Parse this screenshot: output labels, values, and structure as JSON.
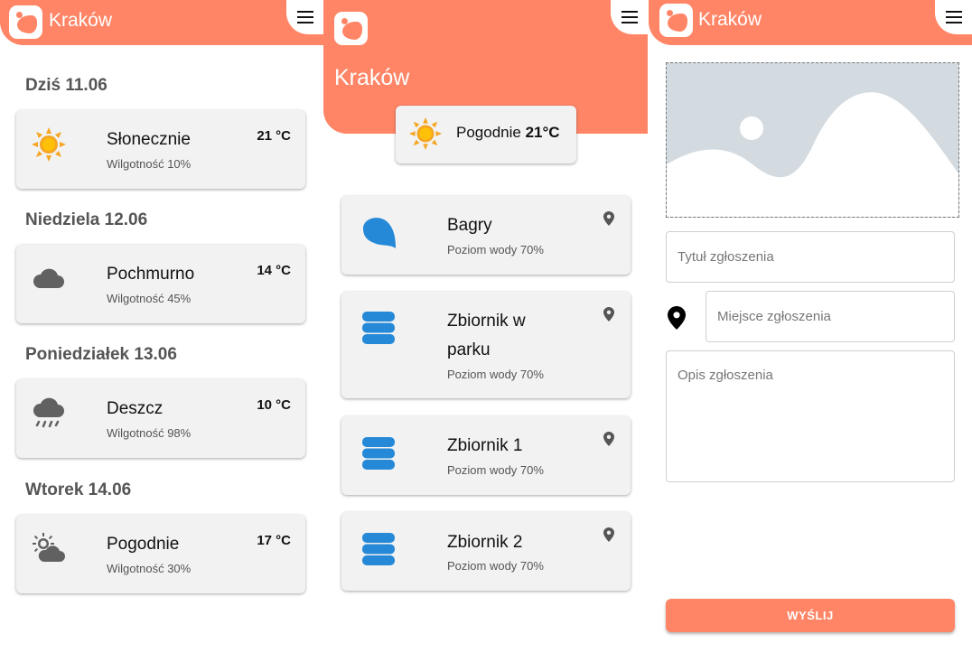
{
  "app": {
    "city": "Kraków",
    "accent": "#ff8566",
    "menu_icon": "hamburger-menu-icon"
  },
  "forecast": {
    "days": [
      {
        "heading": "Dziś 11.06",
        "condition": "Słonecznie",
        "humidity": "Wilgotność 10%",
        "temp": "21 °C",
        "icon": "sun-icon"
      },
      {
        "heading": "Niedziela 12.06",
        "condition": "Pochmurno",
        "humidity": "Wilgotność 45%",
        "temp": "14 °C",
        "icon": "cloud-icon"
      },
      {
        "heading": "Poniedziałek 13.06",
        "condition": "Deszcz",
        "humidity": "Wilgotność 98%",
        "temp": "10 °C",
        "icon": "rain-icon"
      },
      {
        "heading": "Wtorek 14.06",
        "condition": "Pogodnie",
        "humidity": "Wilgotność 30%",
        "temp": "17 °C",
        "icon": "partly-cloudy-icon"
      }
    ]
  },
  "reservoirs": {
    "current_label": "Pogodnie",
    "current_temp": "21°C",
    "items": [
      {
        "name": "Bagry",
        "level": "Poziom wody 70%",
        "icon": "lake-icon"
      },
      {
        "name": "Zbiornik w parku",
        "level": "Poziom wody 70%",
        "icon": "tank-icon"
      },
      {
        "name": "Zbiornik 1",
        "level": "Poziom wody 70%",
        "icon": "tank-icon"
      },
      {
        "name": "Zbiornik 2",
        "level": "Poziom wody 70%",
        "icon": "tank-icon"
      }
    ]
  },
  "report": {
    "title_placeholder": "Tytuł zgłoszenia",
    "place_placeholder": "Miejsce zgłoszenia",
    "description_placeholder": "Opis zgłoszenia",
    "submit_label": "WYŚLIJ"
  }
}
